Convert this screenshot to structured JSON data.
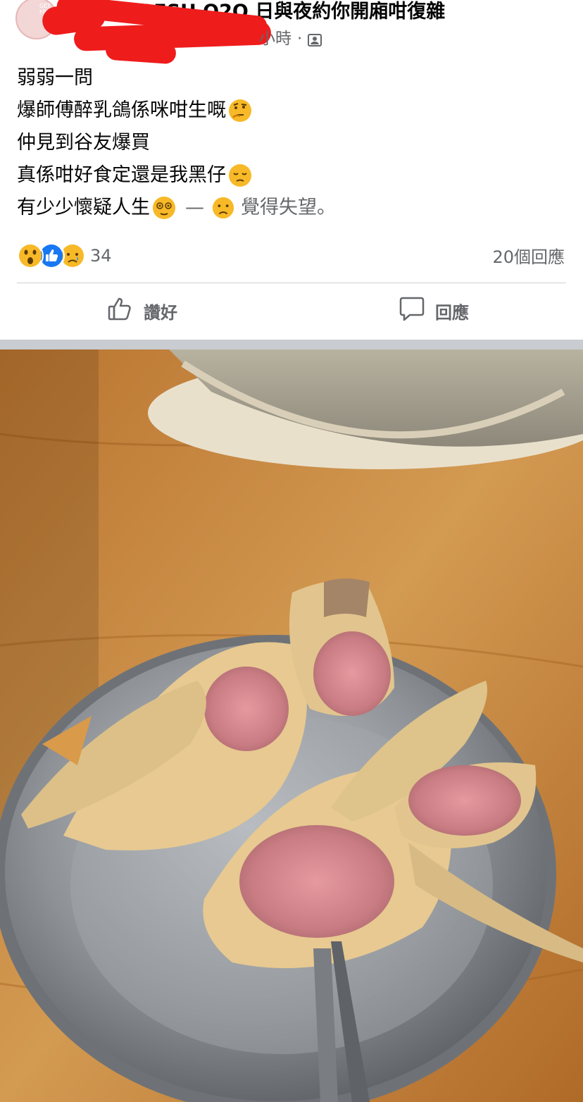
{
  "post": {
    "group_name": "GETFRESH O2O 日與夜約你開廂咁復雜",
    "avatar_text": "GET FRE",
    "time_suffix": "小時",
    "time_dot": "·",
    "privacy_icon": "group-members-icon",
    "lines": [
      "弱弱一問",
      "爆師傅醉乳鴿係咪咁生嘅",
      "仲見到谷友爆買",
      "真係咁好食定還是我黑仔"
    ],
    "feeling_prefix": "有少少懷疑人生",
    "feeling_dash": "—",
    "feeling_text": "覺得失望。",
    "emojis": {
      "line2": "thinking-face-emoji",
      "line4": "pensive-face-emoji",
      "feeling1": "dizzy-face-emoji",
      "feeling2": "disappointed-face-emoji"
    }
  },
  "stats": {
    "reaction_icons": [
      "wow-reaction-icon",
      "like-reaction-icon",
      "sad-reaction-icon"
    ],
    "reaction_count": "34",
    "comments_count": "20個回應"
  },
  "actions": {
    "like_label": "讚好",
    "comment_label": "回應"
  },
  "colors": {
    "redaction": "#ef1c1c",
    "secondary_text": "#65676b",
    "like_blue": "#1877f2",
    "reaction_yellow": "#f7b928",
    "table_wood": "#c98a3e",
    "plate_steel": "#9a9ea3"
  }
}
